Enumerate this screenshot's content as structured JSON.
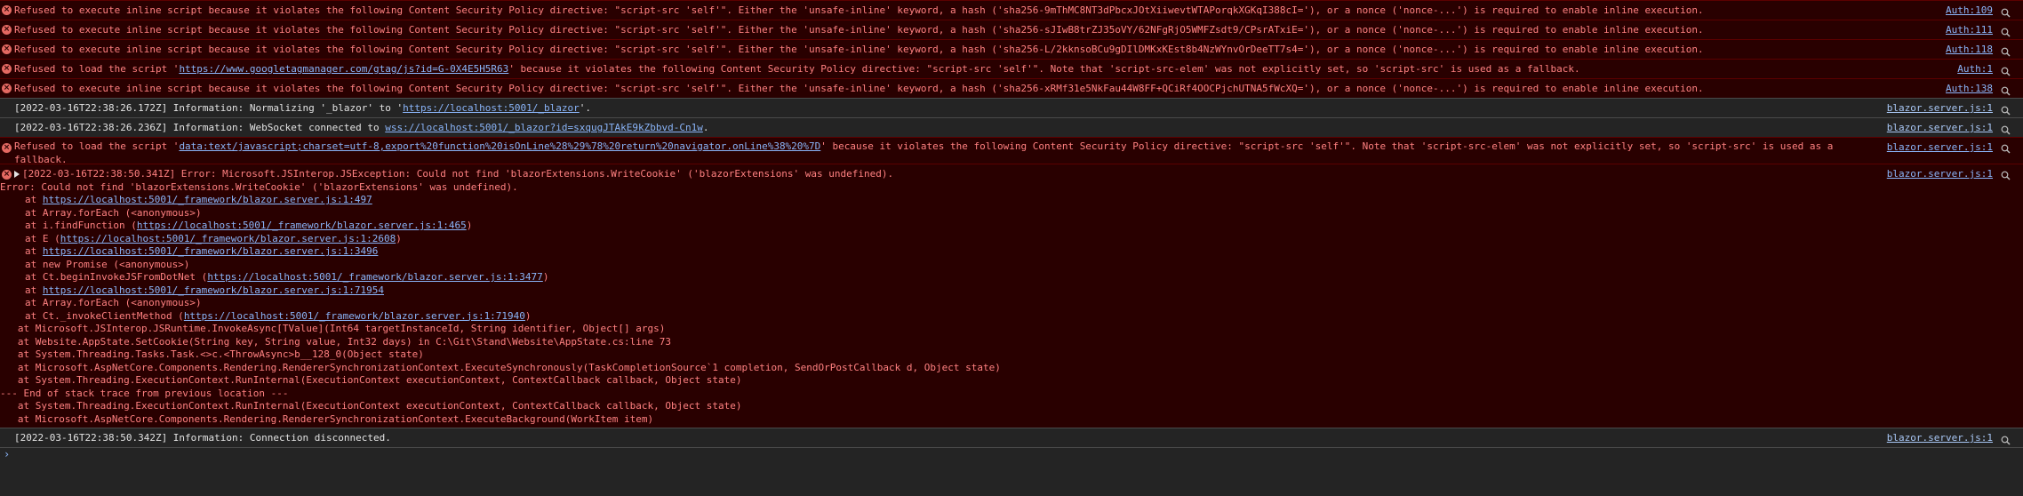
{
  "csp_errors": [
    {
      "text": "Refused to execute inline script because it violates the following Content Security Policy directive: \"script-src 'self'\". Either the 'unsafe-inline' keyword, a hash ('sha256-9mThMC8NT3dPbcxJOtXiiwevtWTAPorqkXGKqI388cI='), or a nonce ('nonce-...') is required to enable inline execution.",
      "src": "Auth:109"
    },
    {
      "text": "Refused to execute inline script because it violates the following Content Security Policy directive: \"script-src 'self'\". Either the 'unsafe-inline' keyword, a hash ('sha256-sJIwB8trZJ35oVY/62NFgRjO5WMFZsdt9/CPsrATxiE='), or a nonce ('nonce-...') is required to enable inline execution.",
      "src": "Auth:111"
    },
    {
      "text": "Refused to execute inline script because it violates the following Content Security Policy directive: \"script-src 'self'\". Either the 'unsafe-inline' keyword, a hash ('sha256-L/2kknsoBCu9gDIlDMKxKEst8b4NzWYnvOrDeeTT7s4='), or a nonce ('nonce-...') is required to enable inline execution.",
      "src": "Auth:118"
    }
  ],
  "gtag_error": {
    "prefix": "Refused to load the script '",
    "link": "https://www.googletagmanager.com/gtag/js?id=G-0X4E5H5R63",
    "suffix": "' because it violates the following Content Security Policy directive: \"script-src 'self'\". Note that 'script-src-elem' was not explicitly set, so 'script-src' is used as a fallback.",
    "src": "Auth:1"
  },
  "csp_error_last": {
    "text": "Refused to execute inline script because it violates the following Content Security Policy directive: \"script-src 'self'\". Either the 'unsafe-inline' keyword, a hash ('sha256-xRMf31e5NkFau44W8FF+QCiRf4OOCPjchUTNA5fWcXQ='), or a nonce ('nonce-...') is required to enable inline execution.",
    "src": "Auth:138"
  },
  "info1": {
    "prefix": "[2022-03-16T22:38:26.172Z] Information: Normalizing '_blazor' to '",
    "link": "https://localhost:5001/_blazor",
    "suffix": "'.",
    "src": "blazor.server.js:1"
  },
  "info2": {
    "prefix": "[2022-03-16T22:38:26.236Z] Information: WebSocket connected to ",
    "link": "wss://localhost:5001/_blazor?id=sxqugJTAkE9kZbbvd-Cn1w",
    "suffix": ".",
    "src": "blazor.server.js:1"
  },
  "datatext_error": {
    "prefix": "Refused to load the script '",
    "link": "data:text/javascript;charset=utf-8,export%20function%20isOnLine%28%29%78%20return%20navigator.onLine%38%20%7D",
    "suffix": "' because it violates the following Content Security Policy directive: \"script-src 'self'\". Note that 'script-src-elem' was not explicitly set, so 'script-src' is used as a",
    "line2": "fallback.",
    "src": "blazor.server.js:1"
  },
  "js_error": {
    "header": "[2022-03-16T22:38:50.341Z] Error: Microsoft.JSInterop.JSException: Could not find 'blazorExtensions.WriteCookie' ('blazorExtensions' was undefined).",
    "line1": "Error: Could not find 'blazorExtensions.WriteCookie' ('blazorExtensions' was undefined).",
    "src": "blazor.server.js:1",
    "frames": [
      {
        "prefix": "at ",
        "link": "https://localhost:5001/_framework/blazor.server.js:1:497",
        "suffix": ""
      },
      {
        "prefix": "at Array.forEach (<anonymous>)",
        "link": "",
        "suffix": ""
      },
      {
        "prefix": "at i.findFunction (",
        "link": "https://localhost:5001/_framework/blazor.server.js:1:465",
        "suffix": ")"
      },
      {
        "prefix": "at E (",
        "link": "https://localhost:5001/_framework/blazor.server.js:1:2608",
        "suffix": ")"
      },
      {
        "prefix": "at ",
        "link": "https://localhost:5001/_framework/blazor.server.js:1:3496",
        "suffix": ""
      },
      {
        "prefix": "at new Promise (<anonymous>)",
        "link": "",
        "suffix": ""
      },
      {
        "prefix": "at Ct.beginInvokeJSFromDotNet (",
        "link": "https://localhost:5001/_framework/blazor.server.js:1:3477",
        "suffix": ")"
      },
      {
        "prefix": "at ",
        "link": "https://localhost:5001/_framework/blazor.server.js:1:71954",
        "suffix": ""
      },
      {
        "prefix": "at Array.forEach (<anonymous>)",
        "link": "",
        "suffix": ""
      },
      {
        "prefix": "at Ct._invokeClientMethod (",
        "link": "https://localhost:5001/_framework/blazor.server.js:1:71940",
        "suffix": ")"
      }
    ],
    "dotnet_frames": [
      "   at Microsoft.JSInterop.JSRuntime.InvokeAsync[TValue](Int64 targetInstanceId, String identifier, Object[] args)",
      "   at Website.AppState.SetCookie(String key, String value, Int32 days) in C:\\Git\\Stand\\Website\\AppState.cs:line 73",
      "   at System.Threading.Tasks.Task.<>c.<ThrowAsync>b__128_0(Object state)",
      "   at Microsoft.AspNetCore.Components.Rendering.RendererSynchronizationContext.ExecuteSynchronously(TaskCompletionSource`1 completion, SendOrPostCallback d, Object state)",
      "   at System.Threading.ExecutionContext.RunInternal(ExecutionContext executionContext, ContextCallback callback, Object state)",
      "--- End of stack trace from previous location ---",
      "   at System.Threading.ExecutionContext.RunInternal(ExecutionContext executionContext, ContextCallback callback, Object state)",
      "   at Microsoft.AspNetCore.Components.Rendering.RendererSynchronizationContext.ExecuteBackground(WorkItem item)"
    ]
  },
  "info3": {
    "text": "[2022-03-16T22:38:50.342Z] Information: Connection disconnected.",
    "src": "blazor.server.js:1"
  },
  "prompt": "›",
  "icons": {
    "error": "error-circle-icon",
    "search": "search-icon",
    "expand": "expand-triangle-icon",
    "prompt": "prompt-chevron-icon"
  }
}
